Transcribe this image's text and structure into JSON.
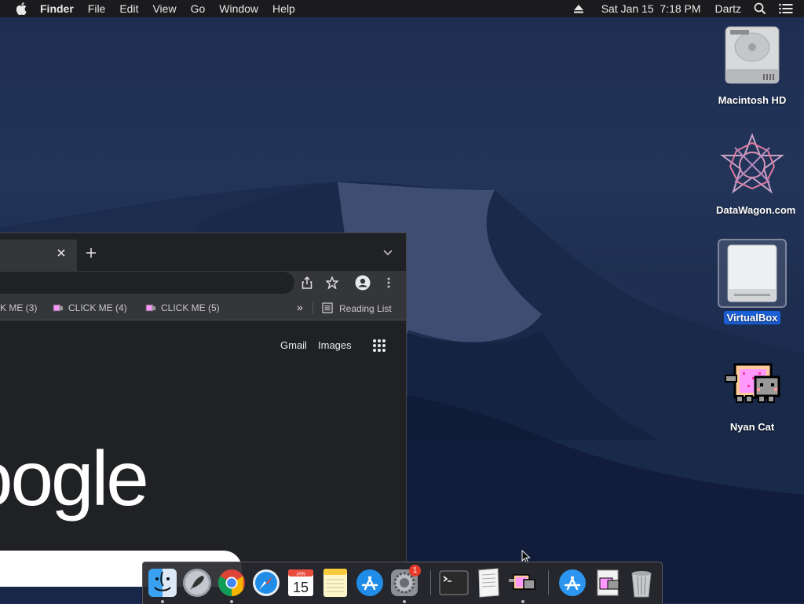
{
  "menubar": {
    "app": "Finder",
    "items": [
      "File",
      "Edit",
      "View",
      "Go",
      "Window",
      "Help"
    ],
    "datetime": "Sat Jan 15  7:18 PM",
    "user": "Dartz"
  },
  "desktop": {
    "icons": [
      {
        "label": "Macintosh HD"
      },
      {
        "label": "DataWagon.com"
      },
      {
        "label": "VirtualBox"
      },
      {
        "label": "Nyan Cat"
      }
    ]
  },
  "browser": {
    "bookmarks": [
      "K ME (3)",
      "CLICK ME (4)",
      "CLICK ME (5)"
    ],
    "reading_list": "Reading List",
    "gmail": "Gmail",
    "images": "Images",
    "logo_text": "oogle"
  },
  "dock": {
    "calendar_month": "JAN",
    "calendar_day": "15",
    "settings_badge": "1"
  },
  "colors": {
    "menubar_bg": "#1b1b1e",
    "selection_blue": "#1a5fd6",
    "chrome_dark": "#202124",
    "chrome_toolbar": "#35363a"
  }
}
